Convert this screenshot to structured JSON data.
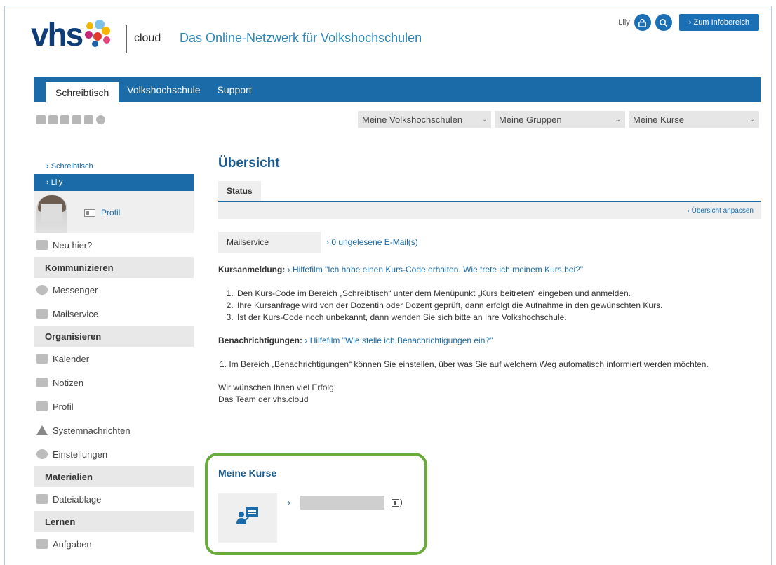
{
  "header": {
    "logo_text": "vhs",
    "cloud_label": "cloud",
    "tagline": "Das Online-Netzwerk für Volkshochschulen",
    "user_name": "Lily",
    "info_button": "› Zum Infobereich"
  },
  "colors": {
    "brand_blue": "#1a6ba8",
    "logo_navy": "#0e3c77",
    "highlight_green": "#6aab3b"
  },
  "nav": {
    "tabs": [
      {
        "label": "Schreibtisch"
      },
      {
        "label": "Volkshochschule"
      },
      {
        "label": "Support"
      }
    ]
  },
  "toolbar": {
    "selects": [
      {
        "label": "Meine Volkshochschulen"
      },
      {
        "label": "Meine Gruppen"
      },
      {
        "label": "Meine Kurse"
      }
    ]
  },
  "sidebar": {
    "link_schreibtisch": "› Schreibtisch",
    "link_lily": "› Lily",
    "profile_label": "Profil",
    "neu_hier": "Neu hier?",
    "sections": [
      {
        "heading": "Kommunizieren",
        "items": [
          "Messenger",
          "Mailservice"
        ]
      },
      {
        "heading": "Organisieren",
        "items": [
          "Kalender",
          "Notizen",
          "Profil",
          "Systemnachrichten",
          "Einstellungen"
        ]
      },
      {
        "heading": "Materialien",
        "items": [
          "Dateiablage"
        ]
      },
      {
        "heading": "Lernen",
        "items": [
          "Aufgaben"
        ]
      }
    ]
  },
  "main": {
    "title": "Übersicht",
    "status_tab": "Status",
    "anpassen_link": "› Übersicht anpassen",
    "mail_label": "Mailservice",
    "mail_link": "› 0 ungelesene E-Mail(s)",
    "kursanmeldung_label": "Kursanmeldung:",
    "kursanmeldung_link": "› Hilfefilm \"Ich habe einen Kurs-Code erhalten. Wie trete ich meinem Kurs bei?\"",
    "kurs_steps": [
      "Den Kurs-Code im Bereich „Schreibtisch“ unter dem Menüpunkt „Kurs beitreten“ eingeben und anmelden.",
      "Ihre Kursanfrage wird von der Dozentin oder Dozent geprüft, dann erfolgt die Aufnahme in den gewünschten Kurs.",
      "Ist der Kurs-Code noch unbekannt, dann wenden Sie sich bitte an Ihre Volkshochschule."
    ],
    "benach_label": "Benachrichtigungen:",
    "benach_link": "› Hilfefilm \"Wie stelle ich Benachrichtigungen ein?\"",
    "benach_steps": [
      "Im Bereich „Benachrichtigungen“ können Sie einstellen, über was Sie auf welchem Weg automatisch informiert werden möchten."
    ],
    "closing_1": "Wir wünschen Ihnen viel Erfolg!",
    "closing_2": "Das Team der vhs.cloud",
    "kurse_title": "Meine Kurse",
    "kurs_arrow": "›",
    "kurs_suffix": ")"
  }
}
